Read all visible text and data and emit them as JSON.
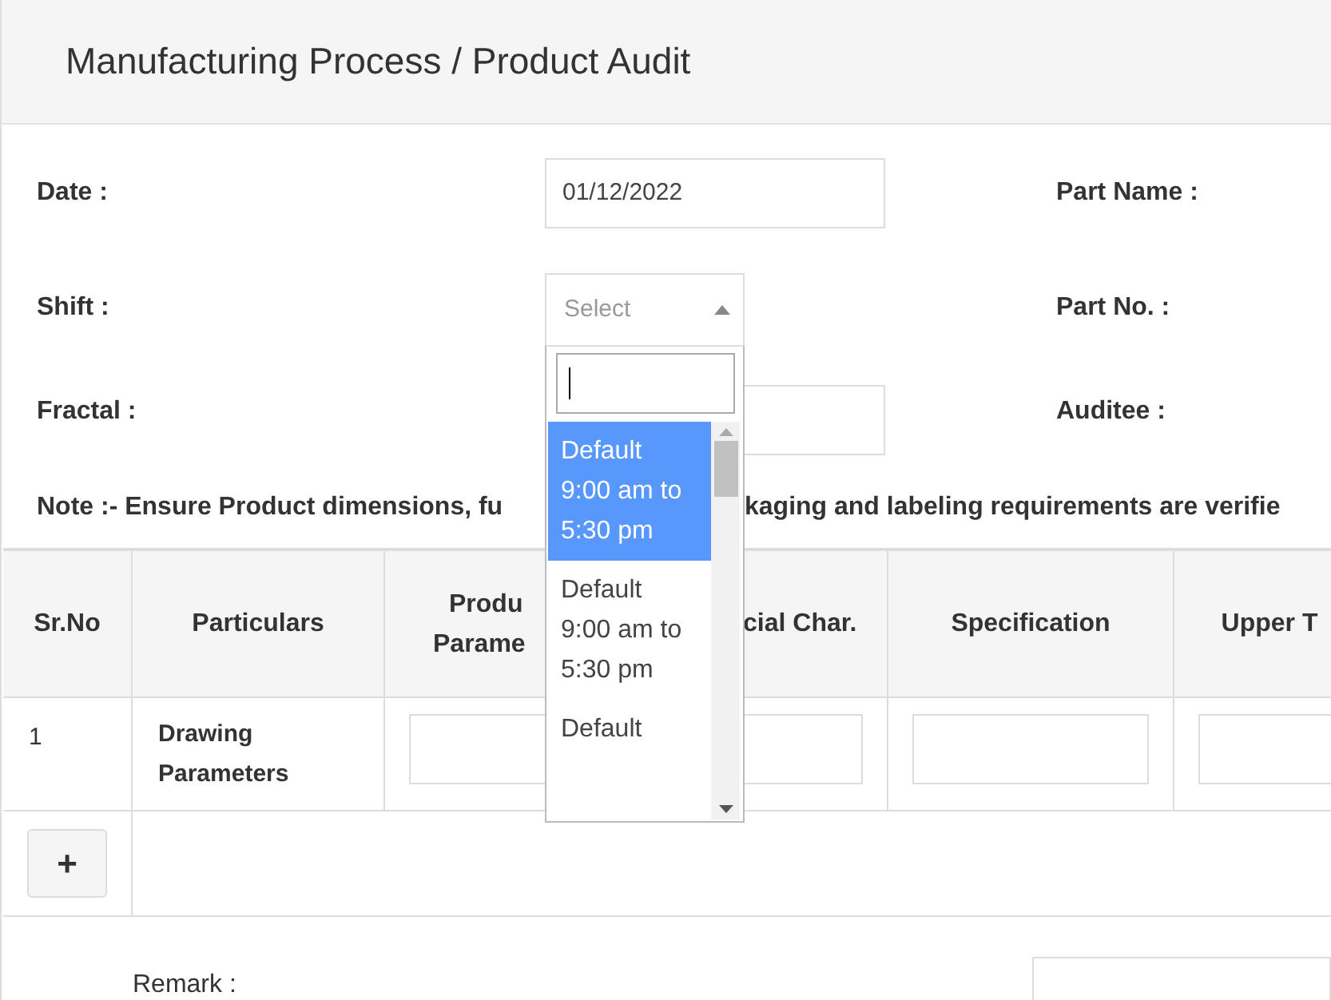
{
  "page_title": "Manufacturing Process / Product Audit",
  "form_rows": [
    {
      "label": "Date :",
      "value": "01/12/2022",
      "right_label": "Part Name :"
    },
    {
      "label": "Shift :",
      "value": "",
      "right_label": "Part No. :"
    },
    {
      "label": "Fractal :",
      "value": "",
      "right_label": "Auditee :"
    }
  ],
  "shift_select": {
    "placeholder": "Select",
    "expanded": true,
    "options": [
      {
        "label": "Default 9:00 am to 5:30 pm",
        "selected": true
      },
      {
        "label": "Default 9:00 am to 5:30 pm",
        "selected": false
      },
      {
        "label": "Default",
        "selected": false
      }
    ]
  },
  "note": {
    "before": "Note :- Ensure Product dimensions, fu",
    "after": "kaging and labeling requirements are verifie"
  },
  "table": {
    "columns": [
      [
        "Sr.No"
      ],
      [
        "Particulars"
      ],
      [
        "Produ",
        "Parame"
      ],
      [
        "cial Char."
      ],
      [
        "Specification"
      ],
      [
        "Upper T"
      ]
    ],
    "rows": [
      {
        "sr_no": "1",
        "particulars": "Drawing Parameters"
      }
    ],
    "add_button": "+"
  },
  "remark": {
    "label": "Remark :"
  }
}
